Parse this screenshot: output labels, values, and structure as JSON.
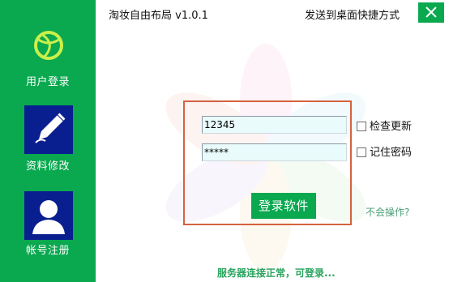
{
  "window": {
    "title": "淘妆自由布局 v1.0.1",
    "shortcut_label": "发送到桌面快捷方式",
    "close_glyph": "✕"
  },
  "sidebar": {
    "items": [
      {
        "label": "用户登录",
        "icon": "basketball-icon"
      },
      {
        "label": "资料修改",
        "icon": "pencil-icon"
      },
      {
        "label": "帐号注册",
        "icon": "user-silhouette-icon"
      }
    ]
  },
  "login": {
    "username_value": "12345",
    "password_value": "*****",
    "submit_label": "登录软件"
  },
  "options": {
    "check_update_label": "检查更新",
    "remember_password_label": "记住密码",
    "check_update_checked": false,
    "remember_password_checked": false
  },
  "help_label": "不会操作?",
  "status": "服务器连接正常，可登录...",
  "colors": {
    "brand_green": "#0aa84f",
    "nav_icon_bg": "#0a1f8f",
    "login_box_border": "#d4623f",
    "input_bg": "#e9fbfb"
  }
}
